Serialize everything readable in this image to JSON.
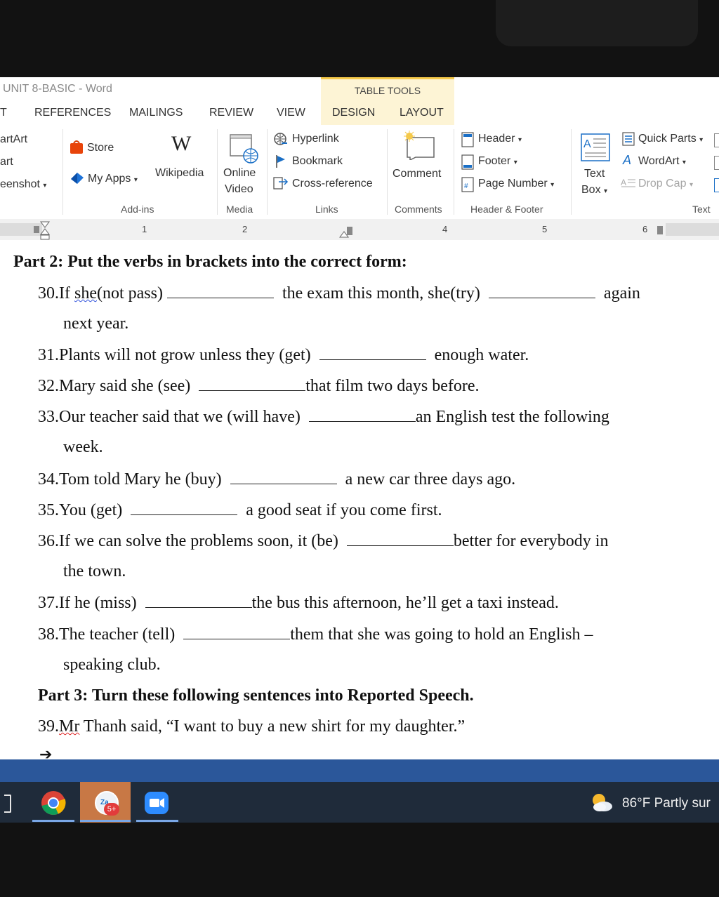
{
  "window": {
    "title": "UNIT 8-BASIC - Word",
    "table_tools": "TABLE TOOLS",
    "tabs": [
      "T",
      "REFERENCES",
      "MAILINGS",
      "REVIEW",
      "VIEW",
      "DESIGN",
      "LAYOUT"
    ]
  },
  "ribbon": {
    "smartart": "artArt",
    "chart": "art",
    "screenshot": "eenshot",
    "store": "Store",
    "my_apps": "My Apps",
    "wikipedia": "Wikipedia",
    "online_video_1": "Online",
    "online_video_2": "Video",
    "hyperlink": "Hyperlink",
    "bookmark": "Bookmark",
    "cross_reference": "Cross-reference",
    "comment": "Comment",
    "header": "Header",
    "footer": "Footer",
    "page_number": "Page Number",
    "text_box_1": "Text",
    "text_box_2": "Box",
    "quick_parts": "Quick Parts",
    "wordart": "WordArt",
    "drop_cap": "Drop Cap",
    "groups": {
      "addins": "Add-ins",
      "media": "Media",
      "links": "Links",
      "comments": "Comments",
      "header_footer": "Header & Footer",
      "text": "Text"
    },
    "wikipedia_glyph": "W"
  },
  "ruler": {
    "marks": [
      "1",
      "2",
      "4",
      "5",
      "6"
    ]
  },
  "document": {
    "part2_heading": "Part 2: Put the verbs in brackets into the correct form:",
    "q30": {
      "num": "30.",
      "a": "If ",
      "b": "she",
      "c": "(not pass)",
      "d": " the exam this month, she(try) ",
      "e": " again",
      "cont": "next year."
    },
    "q31": {
      "num": "31.",
      "a": "Plants will not grow unless they (get) ",
      "b": " enough water."
    },
    "q32": {
      "num": "32.",
      "a": "Mary said she (see) ",
      "b": "that film two days before."
    },
    "q33": {
      "num": "33.",
      "a": "Our teacher said that we (will have) ",
      "b": "an English test the following",
      "cont": "week."
    },
    "q34": {
      "num": "34.",
      "a": "Tom told Mary he (buy) ",
      "b": " a new car three days ago."
    },
    "q35": {
      "num": "35.",
      "a": "You (get) ",
      "b": " a good seat if you come first."
    },
    "q36": {
      "num": "36.",
      "a": "If we can solve the problems soon, it (be) ",
      "b": "better for everybody in",
      "cont": "the town."
    },
    "q37": {
      "num": "37.",
      "a": "If he (miss) ",
      "b": "the bus this afternoon, he’ll get a taxi instead."
    },
    "q38": {
      "num": "38.",
      "a": "The teacher (tell) ",
      "b": "them that she was going to hold an English –",
      "cont": "speaking club."
    },
    "part3_heading": "Part 3: Turn these following sentences into Reported Speech.",
    "q39": {
      "num": "39.",
      "a": "Mr",
      "b": " Thanh said, “I want to buy a new shirt for my daughter.”"
    },
    "arrow": "➔"
  },
  "taskbar": {
    "weather": "86°F  Partly sur",
    "badge": "5+"
  },
  "colors": {
    "word_blue": "#2b579a",
    "table_tools_bg": "#fdf4d5",
    "taskbar": "#1f2b3a"
  }
}
